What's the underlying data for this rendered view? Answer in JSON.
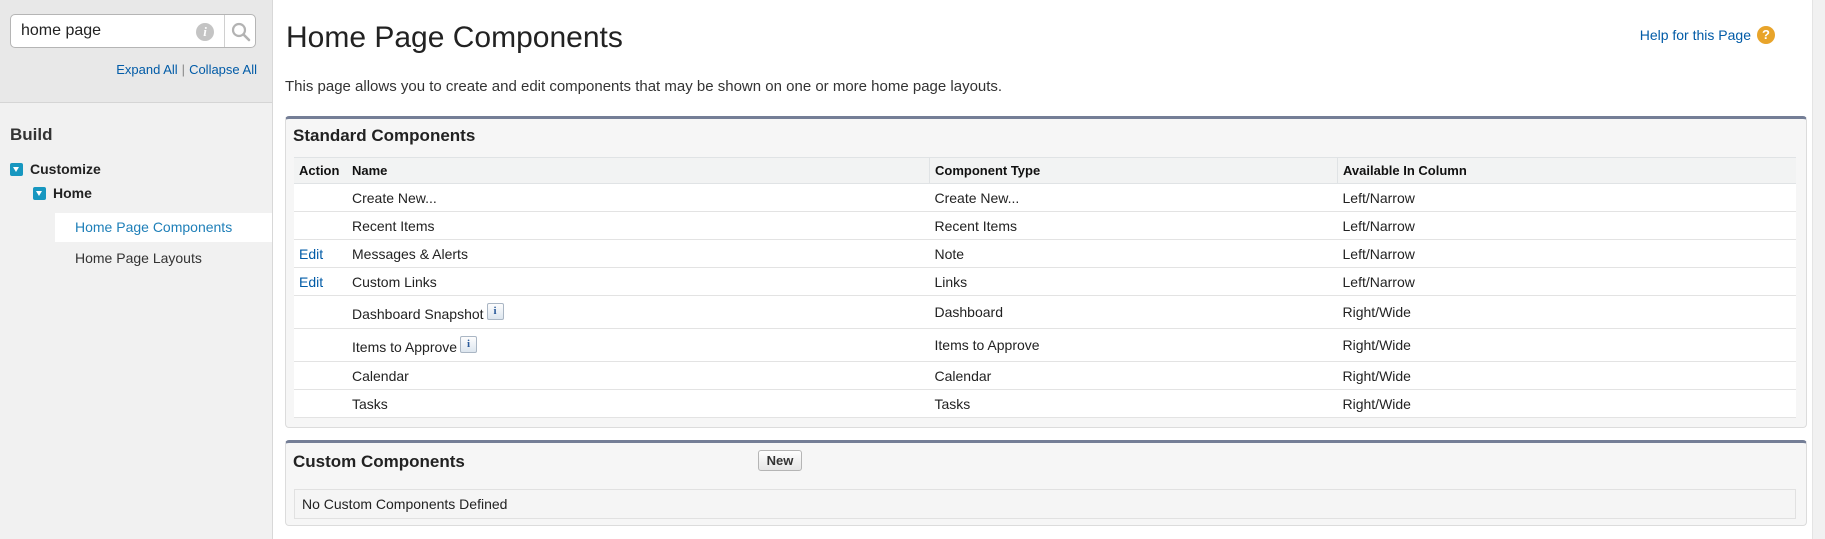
{
  "sidebar": {
    "search_value": "home page",
    "expand_all": "Expand All",
    "separator": "|",
    "collapse_all": "Collapse All",
    "build_heading": "Build",
    "customize_label": "Customize",
    "home_label": "Home",
    "items": [
      {
        "label": "Home Page Components",
        "selected": true
      },
      {
        "label": "Home Page Layouts",
        "selected": false
      }
    ]
  },
  "header": {
    "title": "Home Page Components",
    "help_link": "Help for this Page",
    "help_icon": "?",
    "description": "This page allows you to create and edit components that may be shown on one or more home page layouts."
  },
  "standard_components": {
    "title": "Standard Components",
    "columns": [
      "Action",
      "Name",
      "Component Type",
      "Available In Column"
    ],
    "rows": [
      {
        "action": "",
        "name": "Create New...",
        "info": false,
        "type": "Create New...",
        "column": "Left/Narrow"
      },
      {
        "action": "",
        "name": "Recent Items",
        "info": false,
        "type": "Recent Items",
        "column": "Left/Narrow"
      },
      {
        "action": "Edit",
        "name": "Messages & Alerts",
        "info": false,
        "type": "Note",
        "column": "Left/Narrow"
      },
      {
        "action": "Edit",
        "name": "Custom Links",
        "info": false,
        "type": "Links",
        "column": "Left/Narrow"
      },
      {
        "action": "",
        "name": "Dashboard Snapshot",
        "info": true,
        "type": "Dashboard",
        "column": "Right/Wide"
      },
      {
        "action": "",
        "name": "Items to Approve",
        "info": true,
        "type": "Items to Approve",
        "column": "Right/Wide"
      },
      {
        "action": "",
        "name": "Calendar",
        "info": false,
        "type": "Calendar",
        "column": "Right/Wide"
      },
      {
        "action": "",
        "name": "Tasks",
        "info": false,
        "type": "Tasks",
        "column": "Right/Wide"
      }
    ],
    "info_glyph": "i"
  },
  "custom_components": {
    "title": "Custom Components",
    "new_button": "New",
    "empty_message": "No Custom Components Defined"
  },
  "icons": {
    "search_info": "i"
  },
  "colors": {
    "link": "#015ba7",
    "panel_accent": "#747e96",
    "tree_toggle": "#1797c0",
    "help_icon": "#e8a42a"
  }
}
